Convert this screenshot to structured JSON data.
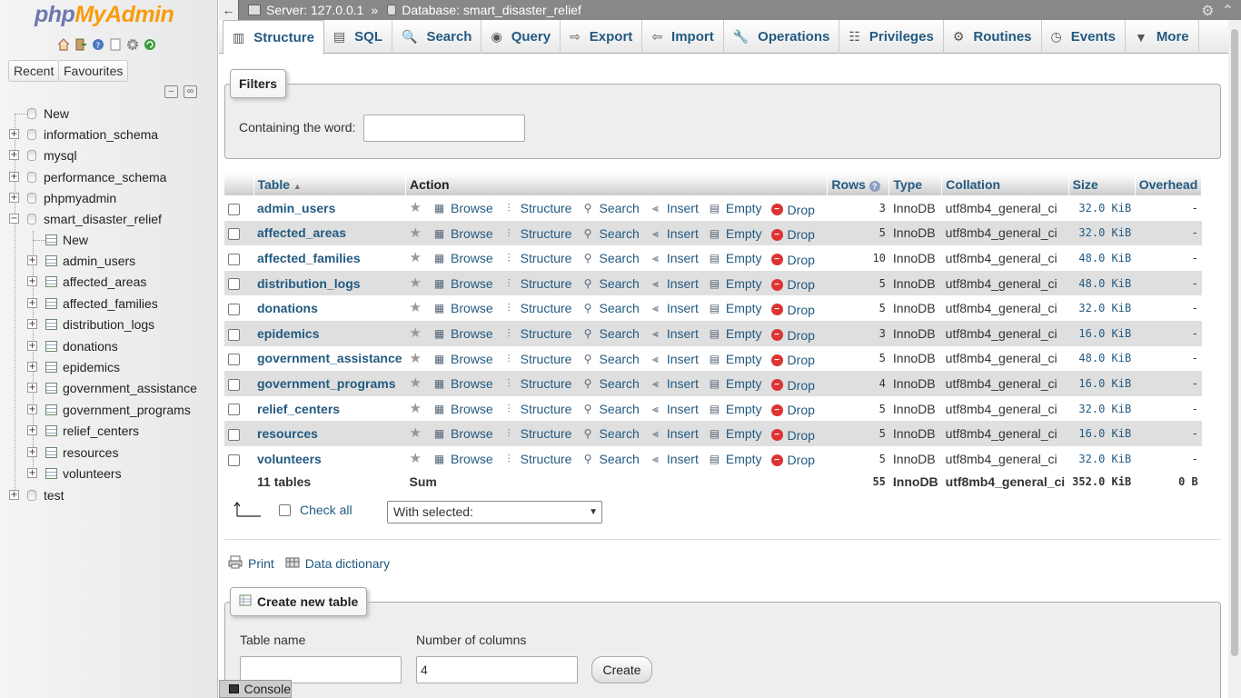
{
  "logo": {
    "php": "php",
    "myadmin": "MyAdmin"
  },
  "sidebar": {
    "recent_label": "Recent",
    "favourites_label": "Favourites",
    "new_label": "New",
    "databases": [
      "information_schema",
      "mysql",
      "performance_schema",
      "phpmyadmin",
      "smart_disaster_relief",
      "test"
    ],
    "active_db": "smart_disaster_relief",
    "active_db_new": "New",
    "tables": [
      "admin_users",
      "affected_areas",
      "affected_families",
      "distribution_logs",
      "donations",
      "epidemics",
      "government_assistance",
      "government_programs",
      "relief_centers",
      "resources",
      "volunteers"
    ]
  },
  "breadcrumb": {
    "server_label": "Server: 127.0.0.1",
    "separator": "»",
    "database_label": "Database: smart_disaster_relief"
  },
  "tabs": [
    {
      "label": "Structure",
      "icon": "structure-icon"
    },
    {
      "label": "SQL",
      "icon": "sql-icon"
    },
    {
      "label": "Search",
      "icon": "search-icon"
    },
    {
      "label": "Query",
      "icon": "query-icon"
    },
    {
      "label": "Export",
      "icon": "export-icon"
    },
    {
      "label": "Import",
      "icon": "import-icon"
    },
    {
      "label": "Operations",
      "icon": "wrench-icon"
    },
    {
      "label": "Privileges",
      "icon": "privileges-icon"
    },
    {
      "label": "Routines",
      "icon": "routines-icon"
    },
    {
      "label": "Events",
      "icon": "events-icon"
    },
    {
      "label": "More",
      "icon": "chevron-down-icon"
    }
  ],
  "filters": {
    "legend": "Filters",
    "label": "Containing the word:",
    "value": ""
  },
  "table_headers": {
    "table": "Table",
    "action": "Action",
    "rows": "Rows",
    "type": "Type",
    "collation": "Collation",
    "size": "Size",
    "overhead": "Overhead"
  },
  "actions": {
    "browse": "Browse",
    "structure": "Structure",
    "search": "Search",
    "insert": "Insert",
    "empty": "Empty",
    "drop": "Drop"
  },
  "rows": [
    {
      "name": "admin_users",
      "rows": "3",
      "type": "InnoDB",
      "collation": "utf8mb4_general_ci",
      "size": "32.0 KiB",
      "overhead": "-"
    },
    {
      "name": "affected_areas",
      "rows": "5",
      "type": "InnoDB",
      "collation": "utf8mb4_general_ci",
      "size": "32.0 KiB",
      "overhead": "-"
    },
    {
      "name": "affected_families",
      "rows": "10",
      "type": "InnoDB",
      "collation": "utf8mb4_general_ci",
      "size": "48.0 KiB",
      "overhead": "-"
    },
    {
      "name": "distribution_logs",
      "rows": "5",
      "type": "InnoDB",
      "collation": "utf8mb4_general_ci",
      "size": "48.0 KiB",
      "overhead": "-"
    },
    {
      "name": "donations",
      "rows": "5",
      "type": "InnoDB",
      "collation": "utf8mb4_general_ci",
      "size": "32.0 KiB",
      "overhead": "-"
    },
    {
      "name": "epidemics",
      "rows": "3",
      "type": "InnoDB",
      "collation": "utf8mb4_general_ci",
      "size": "16.0 KiB",
      "overhead": "-"
    },
    {
      "name": "government_assistance",
      "rows": "5",
      "type": "InnoDB",
      "collation": "utf8mb4_general_ci",
      "size": "48.0 KiB",
      "overhead": "-"
    },
    {
      "name": "government_programs",
      "rows": "4",
      "type": "InnoDB",
      "collation": "utf8mb4_general_ci",
      "size": "16.0 KiB",
      "overhead": "-"
    },
    {
      "name": "relief_centers",
      "rows": "5",
      "type": "InnoDB",
      "collation": "utf8mb4_general_ci",
      "size": "32.0 KiB",
      "overhead": "-"
    },
    {
      "name": "resources",
      "rows": "5",
      "type": "InnoDB",
      "collation": "utf8mb4_general_ci",
      "size": "16.0 KiB",
      "overhead": "-"
    },
    {
      "name": "volunteers",
      "rows": "5",
      "type": "InnoDB",
      "collation": "utf8mb4_general_ci",
      "size": "32.0 KiB",
      "overhead": "-"
    }
  ],
  "footer": {
    "tables_count": "11 tables",
    "sum_label": "Sum",
    "rows_total": "55",
    "type": "InnoDB",
    "collation": "utf8mb4_general_ci",
    "size_total": "352.0 KiB",
    "overhead_total": "0 B"
  },
  "bulk": {
    "check_all_label": "Check all",
    "with_selected": "With selected:"
  },
  "links": {
    "print": "Print",
    "data_dictionary": "Data dictionary"
  },
  "create_table": {
    "legend": "Create new table",
    "table_name_label": "Table name",
    "table_name_value": "",
    "num_columns_label": "Number of columns",
    "num_columns_value": "4",
    "create_button": "Create"
  },
  "console_label": "Console",
  "colors": {
    "link": "#235a81",
    "logo_php": "#6c78af",
    "logo_admin": "#f89c0e",
    "topbar": "#888888",
    "drop": "#dd3333"
  }
}
